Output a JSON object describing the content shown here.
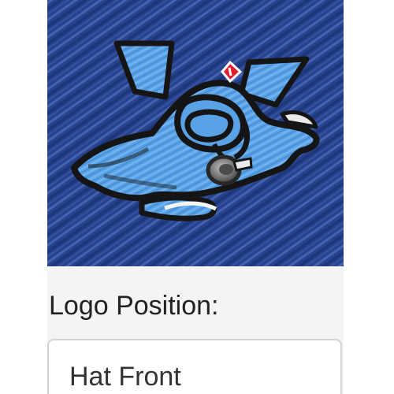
{
  "product": {
    "image_name": "embroidered-scuba-diver-logo"
  },
  "options": {
    "logo_position_label": "Logo Position:",
    "logo_position_value": "Hat Front"
  },
  "colors": {
    "fabric_blue": "#27438e",
    "embroidery_light_blue": "#5aa2e6",
    "embroidery_outline": "#151515",
    "mask_silver": "#808080",
    "flag_red": "#e01f2e",
    "panel_background": "#f4f4f4"
  }
}
